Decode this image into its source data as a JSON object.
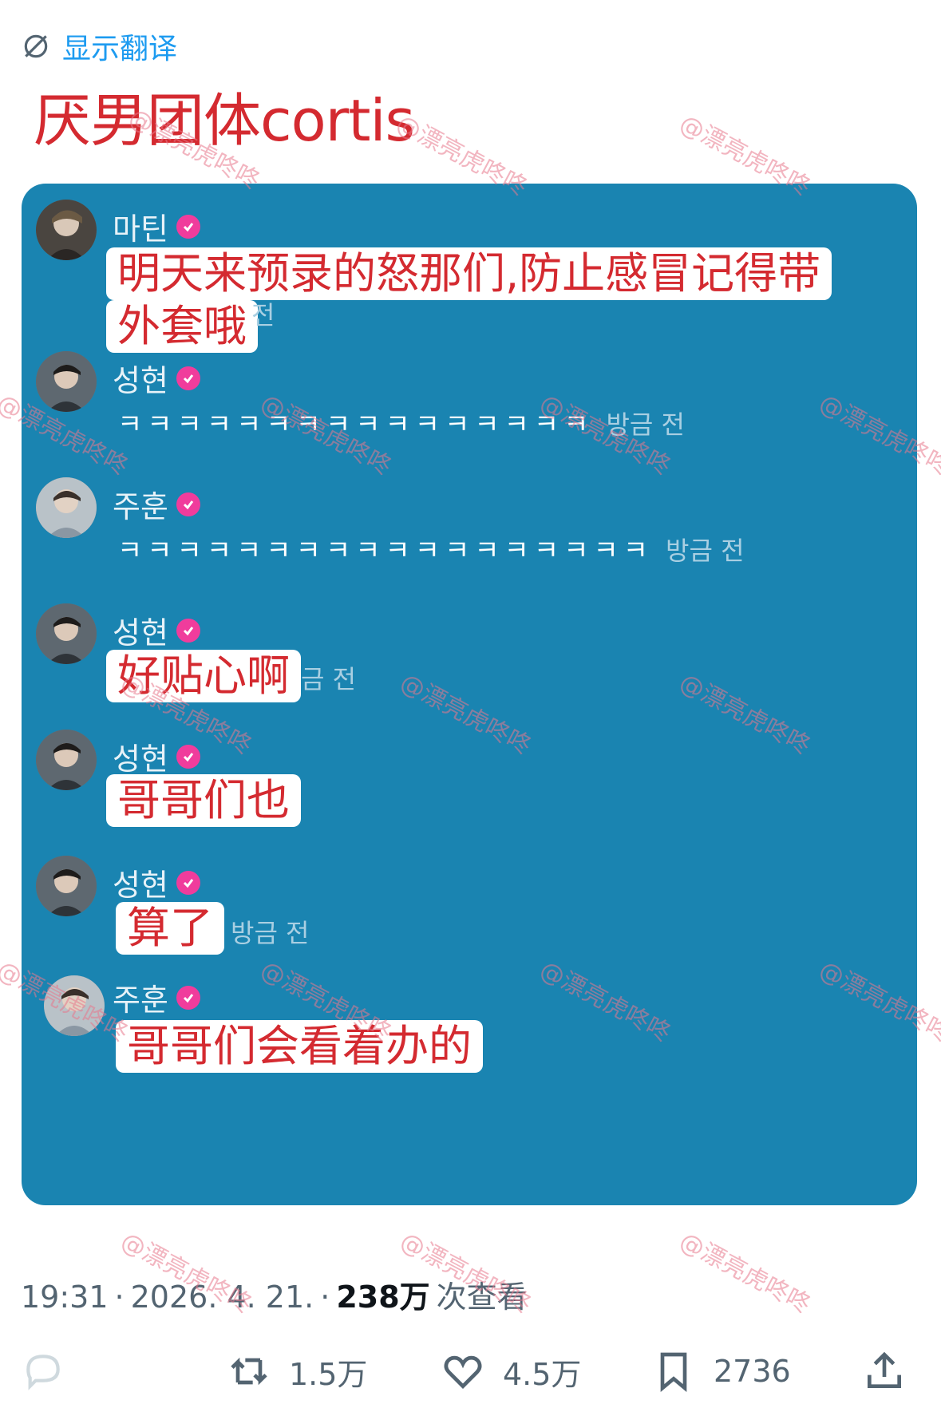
{
  "header": {
    "translate_label": "显示翻译",
    "title": "厌男团体cortis"
  },
  "chat": {
    "messages": [
      {
        "username": "마틴",
        "subtitle_line1": "明天来预录的怒那们,防止感冒记得带",
        "subtitle_line2": "外套哦",
        "time": "전"
      },
      {
        "username": "성현",
        "text": "ㅋㅋㅋㅋㅋㅋㅋㅋㅋㅋㅋㅋㅋㅋㅋㅋ",
        "time": "방금 전"
      },
      {
        "username": "주훈",
        "text": "ㅋㅋㅋㅋㅋㅋㅋㅋㅋㅋㅋㅋㅋㅋㅋㅋㅋㅋ",
        "time": "방금 전"
      },
      {
        "username": "성현",
        "subtitle": "好贴心啊",
        "time": "금 전"
      },
      {
        "username": "성현",
        "subtitle": "哥哥们也"
      },
      {
        "username": "성현",
        "subtitle": "算了",
        "time": "방금 전"
      },
      {
        "username": "주훈",
        "subtitle": "哥哥们会看着办的"
      }
    ]
  },
  "meta": {
    "time": "19:31",
    "sep": "·",
    "date": "2026. 4. 21.",
    "views": "238万",
    "views_label": "次查看"
  },
  "actions": {
    "reply_count": "",
    "retweet_count": "1.5万",
    "like_count": "4.5万",
    "bookmark_count": "2736"
  },
  "watermark": "@漂亮虎咚咚",
  "colors": {
    "accent": "#1d9bf0",
    "chat_bg": "#1a84b1",
    "title_red": "#d42a30",
    "verified_pink": "#f03c9c"
  }
}
